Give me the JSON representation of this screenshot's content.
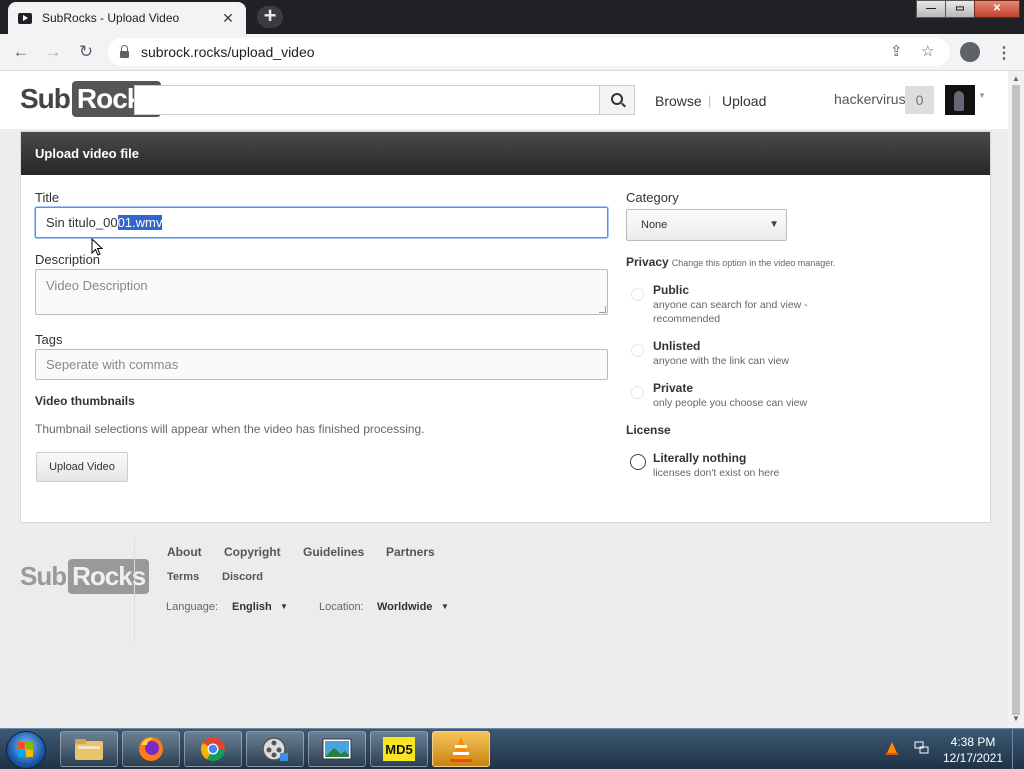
{
  "browser": {
    "tab_title": "SubRocks - Upload Video",
    "tab_close": "✕",
    "new_tab": "+",
    "url": "subrock.rocks/upload_video",
    "window_controls": {
      "minimize": "—",
      "maximize": "▭",
      "close": "✕"
    }
  },
  "site": {
    "logo": {
      "sub": "Sub",
      "rocks": "Rocks"
    },
    "search": {
      "placeholder": "",
      "value": ""
    },
    "nav": {
      "browse": "Browse",
      "separator": "|",
      "upload": "Upload"
    },
    "user": {
      "name": "hackervirus",
      "notifications": "0"
    }
  },
  "upload": {
    "header": "Upload video file",
    "title_label": "Title",
    "title_value_before": "Sin titulo_00",
    "title_value_selected": "01.wmv",
    "description_label": "Description",
    "description_placeholder": "Video Description",
    "tags_label": "Tags",
    "tags_placeholder": "Seperate with commas",
    "thumbnails_label": "Video thumbnails",
    "thumbnails_help": "Thumbnail selections will appear when the video has finished processing.",
    "upload_button": "Upload Video",
    "category_label": "Category",
    "category_value": "None",
    "privacy_label": "Privacy",
    "privacy_note": "Change this option in the video manager.",
    "privacy_options": [
      {
        "title": "Public",
        "desc": "anyone can search for and view - recommended"
      },
      {
        "title": "Unlisted",
        "desc": "anyone with the link can view"
      },
      {
        "title": "Private",
        "desc": "only people you choose can view"
      }
    ],
    "license_label": "License",
    "license_option": {
      "title": "Literally nothing",
      "desc": "licenses don't exist on here"
    }
  },
  "footer": {
    "links": [
      "About",
      "Copyright",
      "Guidelines",
      "Partners"
    ],
    "links2": [
      "Terms",
      "Discord"
    ],
    "language_label": "Language:",
    "language_value": "English",
    "location_label": "Location:",
    "location_value": "Worldwide"
  },
  "taskbar": {
    "md5_label": "MD5",
    "time": "4:38 PM",
    "date": "12/17/2021"
  },
  "colors": {
    "selection": "#3366cc",
    "header_dark": "#262626",
    "taskbar": "#1e3246"
  }
}
